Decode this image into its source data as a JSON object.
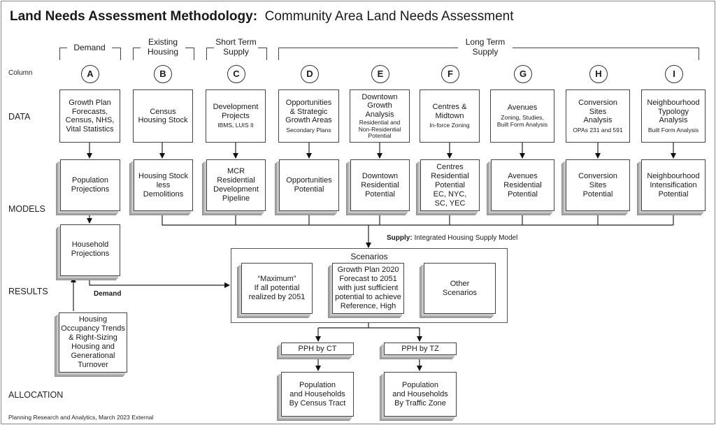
{
  "title": {
    "bold": "Land Needs Assessment Methodology:",
    "rest": "Community Area Land Needs Assessment"
  },
  "row_labels": {
    "column": "Column",
    "data": "DATA",
    "models": "MODELS",
    "results": "RESULTS",
    "allocation": "ALLOCATION"
  },
  "groups": {
    "demand": "Demand",
    "existing_housing": [
      "Existing",
      "Housing"
    ],
    "short_term_supply": [
      "Short Term",
      "Supply"
    ],
    "long_term_supply": [
      "Long Term",
      "Supply"
    ]
  },
  "columns": [
    {
      "letter": "A",
      "data": {
        "main": [
          "Growth Plan",
          "Forecasts,",
          "Census, NHS,",
          "Vital Statistics"
        ],
        "sub": []
      },
      "model": [
        "Population",
        "Projections"
      ]
    },
    {
      "letter": "B",
      "data": {
        "main": [
          "Census",
          "Housing Stock"
        ],
        "sub": []
      },
      "model": [
        "Housing Stock",
        "less",
        "Demolitions"
      ]
    },
    {
      "letter": "C",
      "data": {
        "main": [
          "Development",
          "Projects"
        ],
        "sub": [
          "IBMS, LUIS II"
        ]
      },
      "model": [
        "MCR",
        "Residential",
        "Development",
        "Pipeline"
      ]
    },
    {
      "letter": "D",
      "data": {
        "main": [
          "Opportunities",
          "& Strategic",
          "Growth Areas"
        ],
        "sub": [
          "Secondary Plans"
        ]
      },
      "model": [
        "Opportunities",
        "Potential"
      ]
    },
    {
      "letter": "E",
      "data": {
        "main": [
          "Downtown",
          "Growth",
          "Analysis"
        ],
        "sub": [
          "Residential and",
          "Non-Residential",
          "Potential"
        ]
      },
      "model": [
        "Downtown",
        "Residential",
        "Potential"
      ]
    },
    {
      "letter": "F",
      "data": {
        "main": [
          "Centres &",
          "Midtown"
        ],
        "sub": [
          "In-force Zoning"
        ]
      },
      "model": [
        "Centres",
        "Residential",
        "Potential",
        "EC, NYC,",
        "SC, YEC"
      ]
    },
    {
      "letter": "G",
      "data": {
        "main": [
          "Avenues"
        ],
        "sub": [
          "Zoning, Studies,",
          "Built Form Analysis"
        ]
      },
      "model": [
        "Avenues",
        "Residential",
        "Potential"
      ]
    },
    {
      "letter": "H",
      "data": {
        "main": [
          "Conversion",
          "Sites",
          "Analysis"
        ],
        "sub": [
          "OPAs 231 and 591"
        ]
      },
      "model": [
        "Conversion",
        "Sites",
        "Potential"
      ]
    },
    {
      "letter": "I",
      "data": {
        "main": [
          "Neighbourhood",
          "Typology",
          "Analysis"
        ],
        "sub": [
          "Built Form Analysis"
        ]
      },
      "model": [
        "Neighbourhood",
        "Intensification",
        "Potential"
      ]
    }
  ],
  "household_projections": [
    "Household",
    "Projections"
  ],
  "occupancy_trends": [
    "Housing",
    "Occupancy Trends",
    "& Right-Sizing",
    "Housing and",
    "Generational",
    "Turnover"
  ],
  "supply_note": {
    "bold": "Supply:",
    "rest": "Integrated Housing Supply Model"
  },
  "demand_note": "Demand",
  "scenarios": {
    "title": "Scenarios",
    "items": [
      [
        "“Maximum”",
        "If all potential",
        "realized by 2051"
      ],
      [
        "Growth Plan 2020",
        "Forecast to 2051",
        "with just sufficient",
        "potential to achieve",
        "Reference, High"
      ],
      [
        "Other",
        "Scenarios"
      ]
    ]
  },
  "pph": [
    {
      "label": "PPH by CT",
      "output": [
        "Population",
        "and Households",
        "By Census Tract"
      ]
    },
    {
      "label": "PPH by TZ",
      "output": [
        "Population",
        "and Households",
        "By Traffic Zone"
      ]
    }
  ],
  "footer": "Planning Research and Analytics, March 2023 External"
}
